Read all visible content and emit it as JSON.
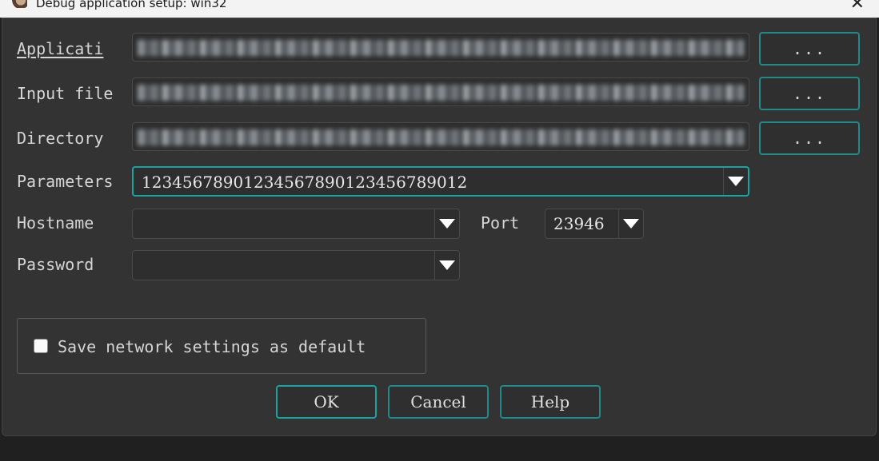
{
  "window": {
    "title": "Debug application setup: win32"
  },
  "labels": {
    "application": "Applicati",
    "input_file": "Input file",
    "directory": "Directory",
    "parameters": "Parameters",
    "hostname": "Hostname",
    "port": "Port",
    "password": "Password"
  },
  "fields": {
    "parameters_value": "12345678901234567890123456789012",
    "hostname_value": "",
    "port_value": "23946",
    "password_value": ""
  },
  "browse_label": "...",
  "checkbox": {
    "label": "Save network settings as default",
    "checked": false
  },
  "buttons": {
    "ok": "OK",
    "cancel": "Cancel",
    "help": "Help"
  },
  "colors": {
    "accent": "#1aa3a3",
    "background": "#333333"
  }
}
